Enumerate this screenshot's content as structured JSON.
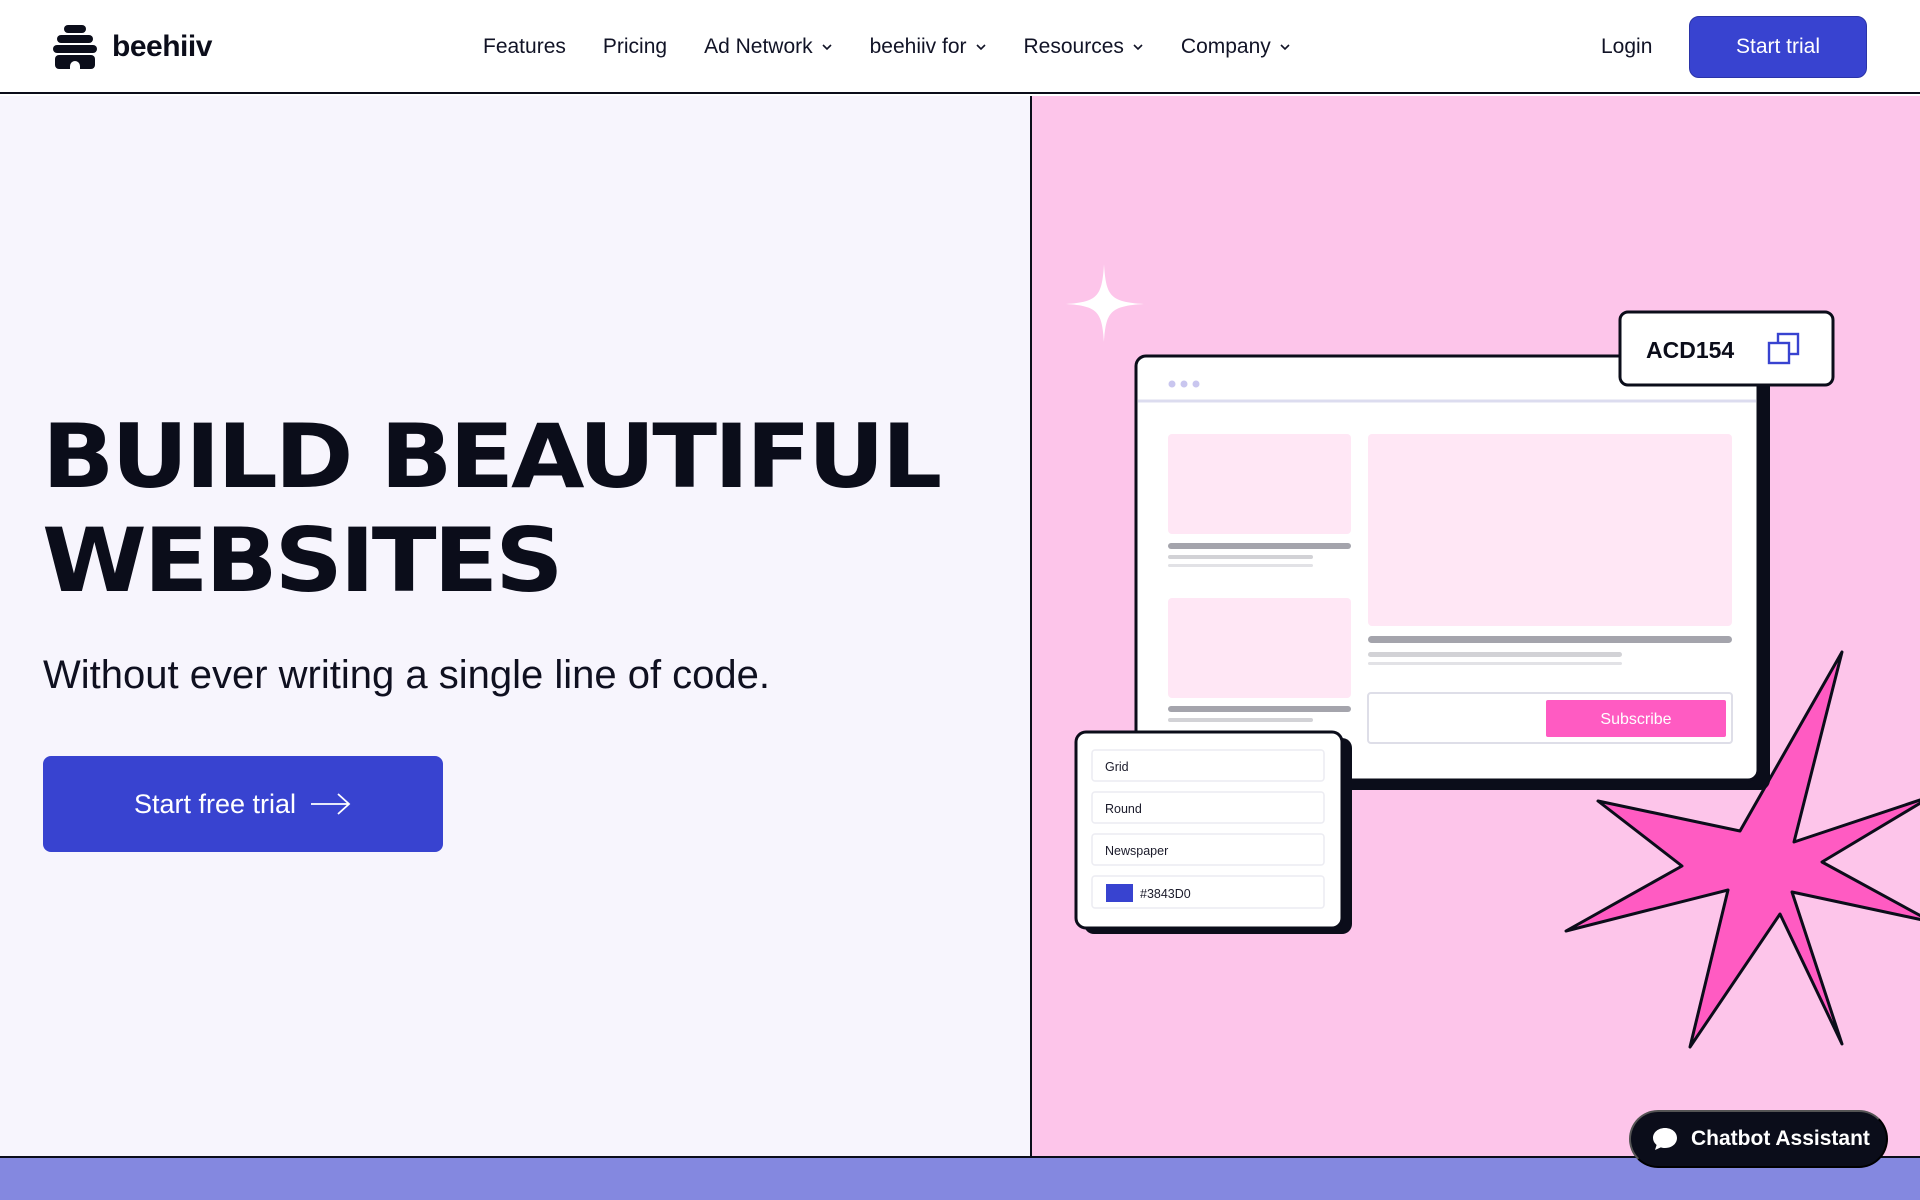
{
  "brand": {
    "name": "beehiiv"
  },
  "nav": {
    "links": [
      {
        "label": "Features",
        "has_dropdown": false
      },
      {
        "label": "Pricing",
        "has_dropdown": false
      },
      {
        "label": "Ad Network",
        "has_dropdown": true
      },
      {
        "label": "beehiiv for",
        "has_dropdown": true
      },
      {
        "label": "Resources",
        "has_dropdown": true
      },
      {
        "label": "Company",
        "has_dropdown": true
      }
    ],
    "login": "Login",
    "cta": "Start trial"
  },
  "hero": {
    "headline_line1": "BUILD BEAUTIFUL",
    "headline_line2": "WEBSITES",
    "subheadline": "Without ever writing a single line of code.",
    "cta": "Start free trial"
  },
  "illustration": {
    "code_tag": "ACD154",
    "subscribe_label": "Subscribe",
    "options": [
      "Grid",
      "Round",
      "Newspaper"
    ],
    "color_value": "#3843D0"
  },
  "chatbot": {
    "label": "Chatbot Assistant"
  },
  "colors": {
    "accent": "#3843d0",
    "pink_bg": "#fdc5ea",
    "hot_pink": "#ff5bc2",
    "band": "#8488e0",
    "dark": "#0b0d1a"
  }
}
